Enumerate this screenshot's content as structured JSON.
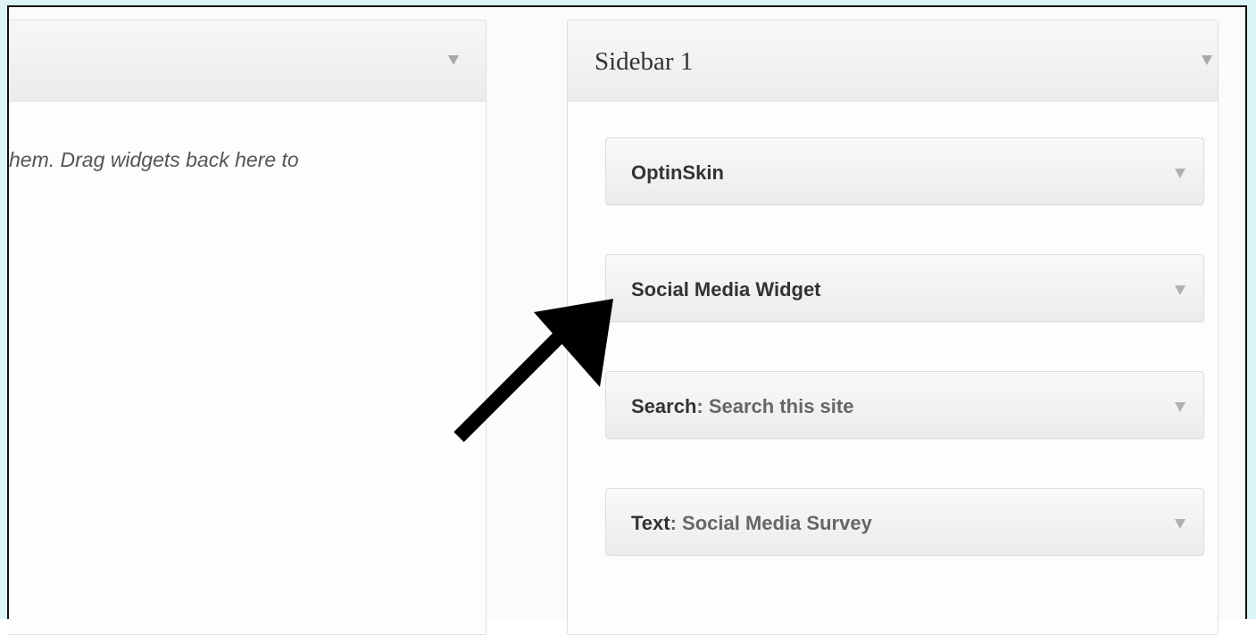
{
  "inactive_widgets": {
    "description": "hem. Drag widgets back here to"
  },
  "sidebar": {
    "title": "Sidebar 1",
    "widgets": [
      {
        "name": "OptinSkin",
        "instance_title": ""
      },
      {
        "name": "Social Media Widget",
        "instance_title": ""
      },
      {
        "name": "Search",
        "instance_title": ": Search this site"
      },
      {
        "name": "Text",
        "instance_title": ": Social Media Survey"
      }
    ]
  },
  "icons": {
    "toggle": "triangle-down-icon",
    "annotation": "black-arrow-icon"
  },
  "colors": {
    "frame": "#dcf3f8",
    "panel_border": "#dfdfdf",
    "widget_bg": "#f2f2f2",
    "arrow": "#000000"
  }
}
